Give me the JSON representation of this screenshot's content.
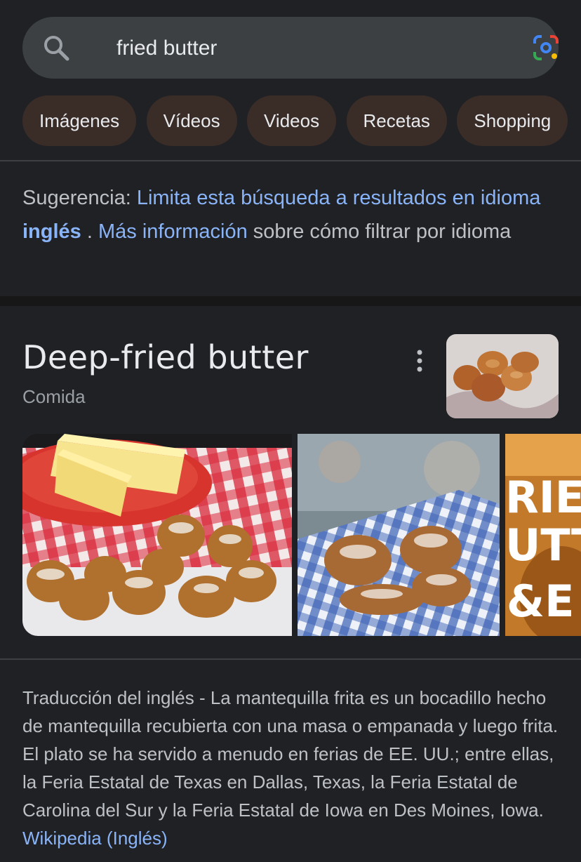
{
  "search": {
    "query": "fried butter"
  },
  "chips": [
    "Imágenes",
    "Vídeos",
    "Videos",
    "Recetas",
    "Shopping"
  ],
  "suggestion": {
    "prefix": "Sugerencia: ",
    "link1": "Limita esta búsqueda a resultados en idioma ",
    "language": "inglés",
    "middle": " . ",
    "link2": "Más información",
    "suffix": " sobre cómo filtrar por idioma"
  },
  "knowledge_panel": {
    "title": "Deep-fried butter",
    "subtitle": "Comida",
    "gallery_overlay_text": "RIE UTT &E",
    "description": "Traducción del inglés - La mantequilla frita es un bocadillo hecho de mantequilla recubierta con una masa o empanada y luego frita. El plato se ha servido a menudo en ferias de EE. UU.; entre ellas, la Feria Estatal de Texas en Dallas, Texas, la Feria Estatal de Carolina del Sur y la Feria Estatal de Iowa en Des Moines, Iowa. ",
    "source_link": "Wikipedia (Inglés)"
  },
  "colors": {
    "background": "#202124",
    "search_bar": "#3c4043",
    "chip": "#3a2d28",
    "link": "#8ab4f8",
    "text_secondary": "#bdc1c6"
  },
  "icons": {
    "search": "search-icon",
    "lens": "google-lens-icon",
    "more": "more-vert-icon"
  }
}
